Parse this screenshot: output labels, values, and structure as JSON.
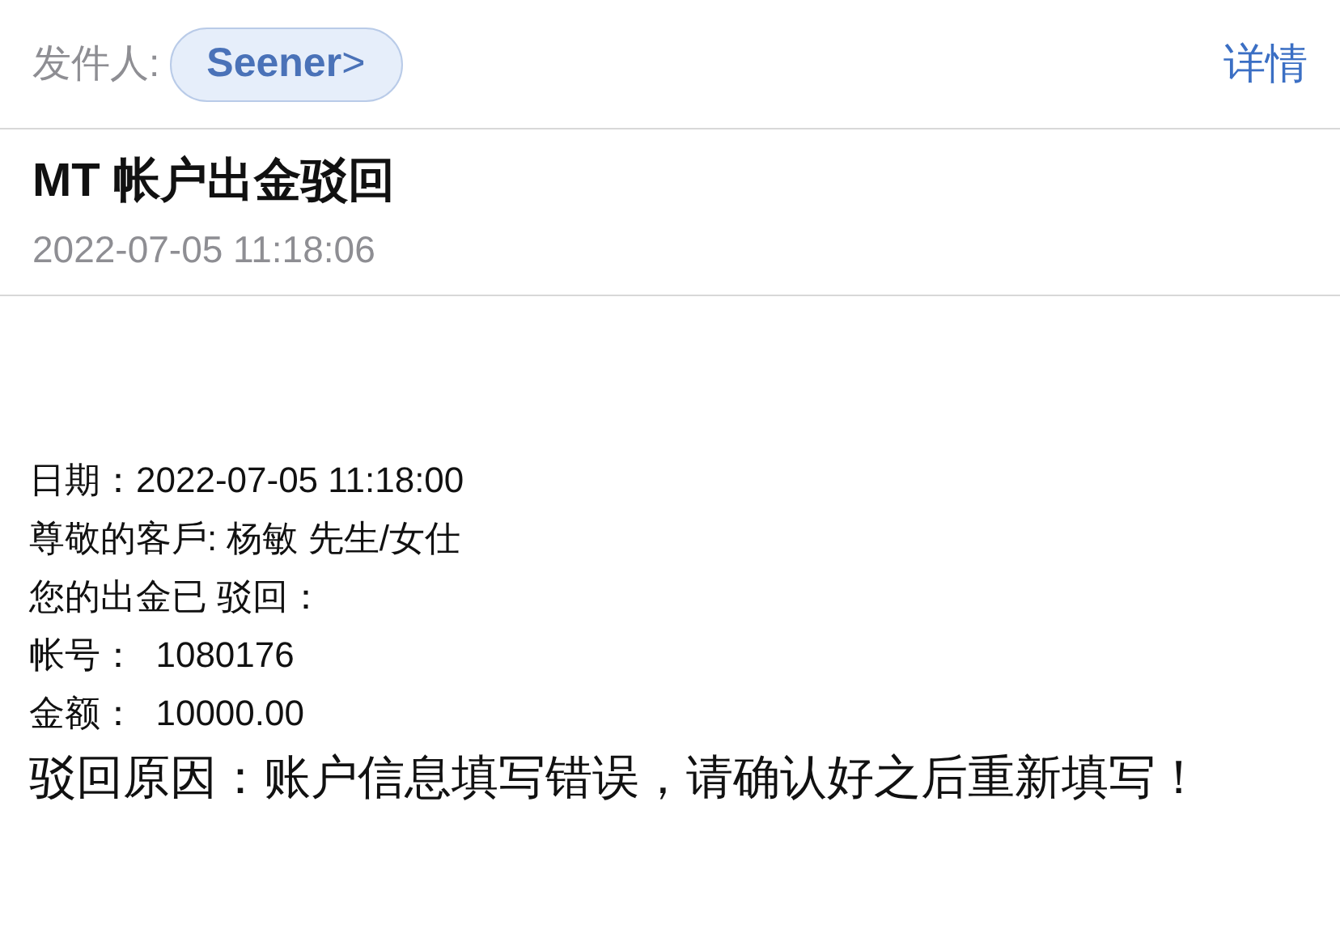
{
  "sender": {
    "label": "发件人:",
    "name": "Seener",
    "chevron": ">"
  },
  "details_link": "详情",
  "subject": "MT 帐户出金驳回",
  "date": "2022-07-05 11:18:06",
  "body_lines": [
    {
      "kind": "small",
      "text": "日期：2022-07-05 11:18:00"
    },
    {
      "kind": "small",
      "text": "尊敬的客戶: 杨敏 先生/女仕"
    },
    {
      "kind": "small",
      "text": "您的出金已 驳回："
    },
    {
      "kind": "small",
      "text": "帐号：  1080176"
    },
    {
      "kind": "small",
      "text": "金额：  10000.00"
    },
    {
      "kind": "large",
      "text": "驳回原因：账户信息填写错误，请确认好之后重新填写！"
    }
  ]
}
